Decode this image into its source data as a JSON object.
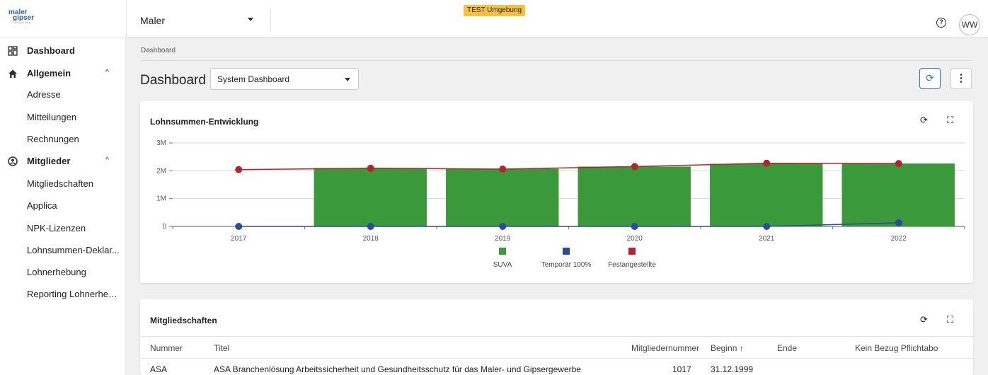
{
  "header": {
    "logo_line1": "maler",
    "logo_line2": "gipser",
    "logo_tagline": "fur bessere wande",
    "org_select_value": "Maler",
    "env_badge": "TEST Umgebung",
    "help_glyph": "?",
    "avatar_initials": "WW"
  },
  "sidebar": {
    "items": [
      {
        "label": "Dashboard",
        "icon": "dashboard-icon",
        "level": "top"
      },
      {
        "label": "Allgemein",
        "icon": "home-icon",
        "level": "top",
        "expanded": true
      },
      {
        "label": "Adresse",
        "level": "sub"
      },
      {
        "label": "Mitteilungen",
        "level": "sub"
      },
      {
        "label": "Rechnungen",
        "level": "sub"
      },
      {
        "label": "Mitglieder",
        "icon": "account-circle-icon",
        "level": "top",
        "expanded": true
      },
      {
        "label": "Mitgliedschaften",
        "level": "sub"
      },
      {
        "label": "Applica",
        "level": "sub"
      },
      {
        "label": "NPK-Lizenzen",
        "level": "sub"
      },
      {
        "label": "Lohnsummen-Deklar...",
        "level": "sub"
      },
      {
        "label": "Lohnerhebung",
        "level": "sub"
      },
      {
        "label": "Reporting Lohnerheb...",
        "level": "sub"
      }
    ],
    "chevron_glyph": "^"
  },
  "main": {
    "breadcrumb": "Dashboard",
    "title": "Dashboard",
    "dashboard_select_value": "System Dashboard",
    "refresh_glyph": "⟳",
    "more_glyph": "⋮"
  },
  "chart_card": {
    "title": "Lohnsummen-Entwicklung",
    "refresh_glyph": "⟳",
    "expand_glyph": "⛶"
  },
  "chart_data": {
    "type": "bar",
    "title": "Lohnsummen-Entwicklung",
    "categories": [
      "2017",
      "2018",
      "2019",
      "2020",
      "2021",
      "2022"
    ],
    "y_ticks": [
      "0",
      "1M",
      "2M",
      "3M"
    ],
    "ylim": [
      0,
      3000000
    ],
    "series": [
      {
        "name": "SUVA",
        "type": "bar",
        "color": "#3a9a3a",
        "values": [
          0,
          2100000,
          2070000,
          2150000,
          2250000,
          2260000
        ]
      },
      {
        "name": "Temporär 100%",
        "type": "line",
        "color": "#2c4a9e",
        "values": [
          0,
          0,
          0,
          0,
          0,
          130000
        ]
      },
      {
        "name": "Festangestellte",
        "type": "line",
        "color": "#b3262c",
        "values": [
          2040000,
          2090000,
          2060000,
          2150000,
          2270000,
          2260000
        ]
      }
    ],
    "legend_position": "bottom",
    "grid": true
  },
  "members_card": {
    "title": "Mitgliedschaften",
    "refresh_glyph": "⟳",
    "expand_glyph": "⛶",
    "columns": [
      "Nummer",
      "Titel",
      "Mitgliedernummer",
      "Beginn ↑",
      "Ende",
      "Kein Bezug Pflichtabo"
    ],
    "rows": [
      [
        "ASA",
        "ASA Branchenlösung Arbeitssicherheit und Gesundheitsschutz für das Maler- und Gipsergewerbe",
        "1017",
        "31.12.1999",
        "",
        ""
      ]
    ]
  }
}
